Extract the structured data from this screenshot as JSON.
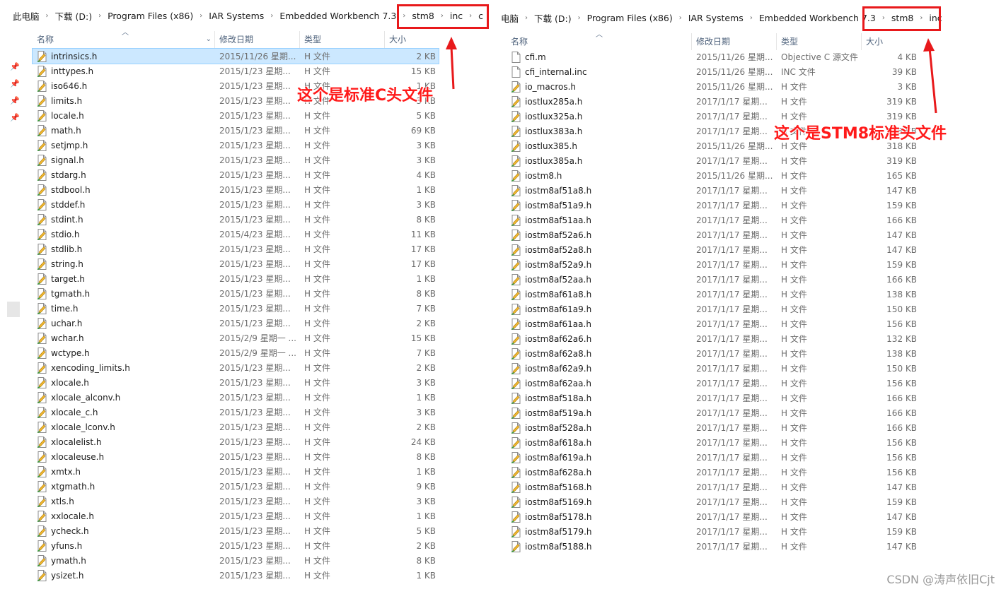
{
  "left": {
    "breadcrumb": [
      "此电脑",
      "下载 (D:)",
      "Program Files (x86)",
      "IAR Systems",
      "Embedded Workbench 7.3",
      "stm8",
      "inc",
      "c"
    ],
    "headers": {
      "name": "名称",
      "date": "修改日期",
      "type": "类型",
      "size": "大小"
    },
    "rows": [
      {
        "name": "intrinsics.h",
        "date": "2015/11/26 星期...",
        "type": "H 文件",
        "size": "2 KB"
      },
      {
        "name": "inttypes.h",
        "date": "2015/1/23 星期...",
        "type": "H 文件",
        "size": "15 KB"
      },
      {
        "name": "iso646.h",
        "date": "2015/1/23 星期...",
        "type": "H 文件",
        "size": "1 KB"
      },
      {
        "name": "limits.h",
        "date": "2015/1/23 星期...",
        "type": "H 文件",
        "size": "3 KB"
      },
      {
        "name": "locale.h",
        "date": "2015/1/23 星期...",
        "type": "H 文件",
        "size": "5 KB"
      },
      {
        "name": "math.h",
        "date": "2015/1/23 星期...",
        "type": "H 文件",
        "size": "69 KB"
      },
      {
        "name": "setjmp.h",
        "date": "2015/1/23 星期...",
        "type": "H 文件",
        "size": "3 KB"
      },
      {
        "name": "signal.h",
        "date": "2015/1/23 星期...",
        "type": "H 文件",
        "size": "3 KB"
      },
      {
        "name": "stdarg.h",
        "date": "2015/1/23 星期...",
        "type": "H 文件",
        "size": "4 KB"
      },
      {
        "name": "stdbool.h",
        "date": "2015/1/23 星期...",
        "type": "H 文件",
        "size": "1 KB"
      },
      {
        "name": "stddef.h",
        "date": "2015/1/23 星期...",
        "type": "H 文件",
        "size": "3 KB"
      },
      {
        "name": "stdint.h",
        "date": "2015/1/23 星期...",
        "type": "H 文件",
        "size": "8 KB"
      },
      {
        "name": "stdio.h",
        "date": "2015/4/23 星期...",
        "type": "H 文件",
        "size": "11 KB"
      },
      {
        "name": "stdlib.h",
        "date": "2015/1/23 星期...",
        "type": "H 文件",
        "size": "17 KB"
      },
      {
        "name": "string.h",
        "date": "2015/1/23 星期...",
        "type": "H 文件",
        "size": "17 KB"
      },
      {
        "name": "target.h",
        "date": "2015/1/23 星期...",
        "type": "H 文件",
        "size": "1 KB"
      },
      {
        "name": "tgmath.h",
        "date": "2015/1/23 星期...",
        "type": "H 文件",
        "size": "8 KB"
      },
      {
        "name": "time.h",
        "date": "2015/1/23 星期...",
        "type": "H 文件",
        "size": "7 KB"
      },
      {
        "name": "uchar.h",
        "date": "2015/1/23 星期...",
        "type": "H 文件",
        "size": "2 KB"
      },
      {
        "name": "wchar.h",
        "date": "2015/2/9 星期一 ...",
        "type": "H 文件",
        "size": "15 KB"
      },
      {
        "name": "wctype.h",
        "date": "2015/2/9 星期一 ...",
        "type": "H 文件",
        "size": "7 KB"
      },
      {
        "name": "xencoding_limits.h",
        "date": "2015/1/23 星期...",
        "type": "H 文件",
        "size": "2 KB"
      },
      {
        "name": "xlocale.h",
        "date": "2015/1/23 星期...",
        "type": "H 文件",
        "size": "3 KB"
      },
      {
        "name": "xlocale_alconv.h",
        "date": "2015/1/23 星期...",
        "type": "H 文件",
        "size": "1 KB"
      },
      {
        "name": "xlocale_c.h",
        "date": "2015/1/23 星期...",
        "type": "H 文件",
        "size": "3 KB"
      },
      {
        "name": "xlocale_lconv.h",
        "date": "2015/1/23 星期...",
        "type": "H 文件",
        "size": "2 KB"
      },
      {
        "name": "xlocalelist.h",
        "date": "2015/1/23 星期...",
        "type": "H 文件",
        "size": "24 KB"
      },
      {
        "name": "xlocaleuse.h",
        "date": "2015/1/23 星期...",
        "type": "H 文件",
        "size": "8 KB"
      },
      {
        "name": "xmtx.h",
        "date": "2015/1/23 星期...",
        "type": "H 文件",
        "size": "1 KB"
      },
      {
        "name": "xtgmath.h",
        "date": "2015/1/23 星期...",
        "type": "H 文件",
        "size": "9 KB"
      },
      {
        "name": "xtls.h",
        "date": "2015/1/23 星期...",
        "type": "H 文件",
        "size": "3 KB"
      },
      {
        "name": "xxlocale.h",
        "date": "2015/1/23 星期...",
        "type": "H 文件",
        "size": "1 KB"
      },
      {
        "name": "ycheck.h",
        "date": "2015/1/23 星期...",
        "type": "H 文件",
        "size": "5 KB"
      },
      {
        "name": "yfuns.h",
        "date": "2015/1/23 星期...",
        "type": "H 文件",
        "size": "2 KB"
      },
      {
        "name": "ymath.h",
        "date": "2015/1/23 星期...",
        "type": "H 文件",
        "size": "8 KB"
      },
      {
        "name": "ysizet.h",
        "date": "2015/1/23 星期...",
        "type": "H 文件",
        "size": "1 KB"
      }
    ],
    "annotation": "这个是标准C头文件"
  },
  "right": {
    "breadcrumb": [
      "电脑",
      "下载 (D:)",
      "Program Files (x86)",
      "IAR Systems",
      "Embedded Workbench 7.3",
      "stm8",
      "inc"
    ],
    "headers": {
      "name": "名称",
      "date": "修改日期",
      "type": "类型",
      "size": "大小"
    },
    "rows": [
      {
        "name": "cfi.m",
        "date": "2015/11/26 星期...",
        "type": "Objective C 源文件",
        "size": "4 KB",
        "icon": "plain"
      },
      {
        "name": "cfi_internal.inc",
        "date": "2015/11/26 星期...",
        "type": "INC 文件",
        "size": "39 KB",
        "icon": "plain"
      },
      {
        "name": "io_macros.h",
        "date": "2015/11/26 星期...",
        "type": "H 文件",
        "size": "3 KB"
      },
      {
        "name": "iostlux285a.h",
        "date": "2017/1/17 星期...",
        "type": "H 文件",
        "size": "319 KB"
      },
      {
        "name": "iostlux325a.h",
        "date": "2017/1/17 星期...",
        "type": "H 文件",
        "size": "319 KB"
      },
      {
        "name": "iostlux383a.h",
        "date": "2017/1/17 星期...",
        "type": "H 文件",
        "size": "318 KB"
      },
      {
        "name": "iostlux385.h",
        "date": "2015/11/26 星期...",
        "type": "H 文件",
        "size": "318 KB"
      },
      {
        "name": "iostlux385a.h",
        "date": "2017/1/17 星期...",
        "type": "H 文件",
        "size": "319 KB"
      },
      {
        "name": "iostm8.h",
        "date": "2015/11/26 星期...",
        "type": "H 文件",
        "size": "165 KB"
      },
      {
        "name": "iostm8af51a8.h",
        "date": "2017/1/17 星期...",
        "type": "H 文件",
        "size": "147 KB"
      },
      {
        "name": "iostm8af51a9.h",
        "date": "2017/1/17 星期...",
        "type": "H 文件",
        "size": "159 KB"
      },
      {
        "name": "iostm8af51aa.h",
        "date": "2017/1/17 星期...",
        "type": "H 文件",
        "size": "166 KB"
      },
      {
        "name": "iostm8af52a6.h",
        "date": "2017/1/17 星期...",
        "type": "H 文件",
        "size": "147 KB"
      },
      {
        "name": "iostm8af52a8.h",
        "date": "2017/1/17 星期...",
        "type": "H 文件",
        "size": "147 KB"
      },
      {
        "name": "iostm8af52a9.h",
        "date": "2017/1/17 星期...",
        "type": "H 文件",
        "size": "159 KB"
      },
      {
        "name": "iostm8af52aa.h",
        "date": "2017/1/17 星期...",
        "type": "H 文件",
        "size": "166 KB"
      },
      {
        "name": "iostm8af61a8.h",
        "date": "2017/1/17 星期...",
        "type": "H 文件",
        "size": "138 KB"
      },
      {
        "name": "iostm8af61a9.h",
        "date": "2017/1/17 星期...",
        "type": "H 文件",
        "size": "150 KB"
      },
      {
        "name": "iostm8af61aa.h",
        "date": "2017/1/17 星期...",
        "type": "H 文件",
        "size": "156 KB"
      },
      {
        "name": "iostm8af62a6.h",
        "date": "2017/1/17 星期...",
        "type": "H 文件",
        "size": "132 KB"
      },
      {
        "name": "iostm8af62a8.h",
        "date": "2017/1/17 星期...",
        "type": "H 文件",
        "size": "138 KB"
      },
      {
        "name": "iostm8af62a9.h",
        "date": "2017/1/17 星期...",
        "type": "H 文件",
        "size": "150 KB"
      },
      {
        "name": "iostm8af62aa.h",
        "date": "2017/1/17 星期...",
        "type": "H 文件",
        "size": "156 KB"
      },
      {
        "name": "iostm8af518a.h",
        "date": "2017/1/17 星期...",
        "type": "H 文件",
        "size": "166 KB"
      },
      {
        "name": "iostm8af519a.h",
        "date": "2017/1/17 星期...",
        "type": "H 文件",
        "size": "166 KB"
      },
      {
        "name": "iostm8af528a.h",
        "date": "2017/1/17 星期...",
        "type": "H 文件",
        "size": "166 KB"
      },
      {
        "name": "iostm8af618a.h",
        "date": "2017/1/17 星期...",
        "type": "H 文件",
        "size": "156 KB"
      },
      {
        "name": "iostm8af619a.h",
        "date": "2017/1/17 星期...",
        "type": "H 文件",
        "size": "156 KB"
      },
      {
        "name": "iostm8af628a.h",
        "date": "2017/1/17 星期...",
        "type": "H 文件",
        "size": "156 KB"
      },
      {
        "name": "iostm8af5168.h",
        "date": "2017/1/17 星期...",
        "type": "H 文件",
        "size": "147 KB"
      },
      {
        "name": "iostm8af5169.h",
        "date": "2017/1/17 星期...",
        "type": "H 文件",
        "size": "159 KB"
      },
      {
        "name": "iostm8af5178.h",
        "date": "2017/1/17 星期...",
        "type": "H 文件",
        "size": "147 KB"
      },
      {
        "name": "iostm8af5179.h",
        "date": "2017/1/17 星期...",
        "type": "H 文件",
        "size": "159 KB"
      },
      {
        "name": "iostm8af5188.h",
        "date": "2017/1/17 星期...",
        "type": "H 文件",
        "size": "147 KB"
      }
    ],
    "annotation": "这个是STM8标准头文件"
  },
  "watermark": "CSDN @涛声依旧Cjt",
  "colors": {
    "annotation": "#ff1a1a",
    "highlight_box": "#e8191b",
    "selection": "#cce8ff"
  }
}
